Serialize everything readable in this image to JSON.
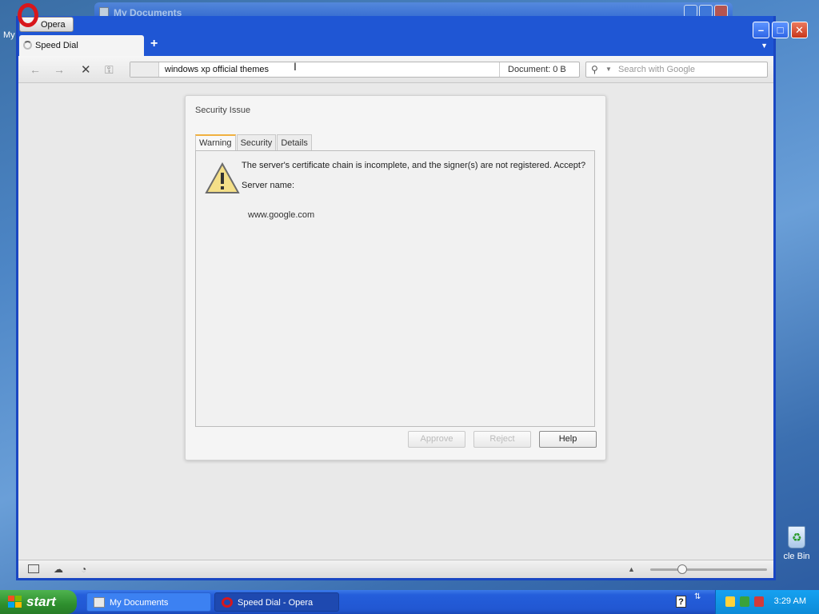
{
  "desktop": {
    "bg_window_title": "My Documents",
    "left_icon_label": "My",
    "recycle_bin_label": "cle Bin"
  },
  "opera": {
    "menu_button_label": "Opera",
    "tabs": [
      {
        "label": "Speed Dial",
        "active": true
      }
    ],
    "new_tab_label": "+",
    "address": {
      "value": "windows xp official themes",
      "document_size": "Document:   0 B"
    },
    "search": {
      "placeholder": "Search with Google"
    }
  },
  "dialog": {
    "title": "Security Issue",
    "tabs": [
      "Warning",
      "Security",
      "Details"
    ],
    "active_tab": "Warning",
    "message": "The server's certificate chain is incomplete, and the signer(s) are not registered. Accept?",
    "server_label": "Server name:",
    "server_name": "www.google.com",
    "buttons": {
      "approve": "Approve",
      "reject": "Reject",
      "help": "Help"
    }
  },
  "taskbar": {
    "start_label": "start",
    "tasks": [
      {
        "label": "My Documents",
        "active": false
      },
      {
        "label": "Speed Dial - Opera",
        "active": true
      }
    ],
    "clock": "3:29 AM"
  },
  "colors": {
    "xp_blue": "#2157d2",
    "start_green": "#2e8f2e",
    "dialog_tab_accent": "#f0b040",
    "close_red": "#c8371b"
  }
}
